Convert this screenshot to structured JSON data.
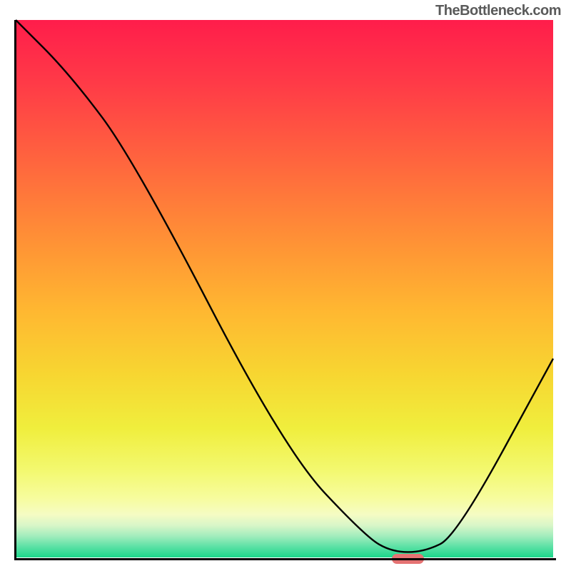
{
  "attribution": "TheBottleneck.com",
  "colors": {
    "curve": "#000000",
    "marker": "#e57373"
  },
  "chart_data": {
    "type": "line",
    "title": "",
    "xlabel": "",
    "ylabel": "",
    "xlim": [
      0,
      100
    ],
    "ylim": [
      0,
      100
    ],
    "x": [
      0,
      10,
      22,
      50,
      65,
      70,
      76,
      82,
      100
    ],
    "values": [
      100,
      90,
      74,
      20,
      4,
      1,
      1,
      4,
      37
    ],
    "marker_x_range": [
      70,
      76
    ],
    "gradient_stops": [
      {
        "pos": 0.0,
        "color": "#ff1d4b"
      },
      {
        "pos": 0.12,
        "color": "#ff3b47"
      },
      {
        "pos": 0.28,
        "color": "#ff6a3d"
      },
      {
        "pos": 0.42,
        "color": "#ff9435"
      },
      {
        "pos": 0.54,
        "color": "#ffb731"
      },
      {
        "pos": 0.66,
        "color": "#f7d631"
      },
      {
        "pos": 0.76,
        "color": "#f0ee3d"
      },
      {
        "pos": 0.84,
        "color": "#f3f971"
      },
      {
        "pos": 0.89,
        "color": "#f7fc9e"
      },
      {
        "pos": 0.92,
        "color": "#f5fcc3"
      },
      {
        "pos": 0.94,
        "color": "#d9f6c8"
      },
      {
        "pos": 0.96,
        "color": "#a3edbd"
      },
      {
        "pos": 0.98,
        "color": "#5ce1a5"
      },
      {
        "pos": 1.0,
        "color": "#1cd78b"
      }
    ]
  }
}
